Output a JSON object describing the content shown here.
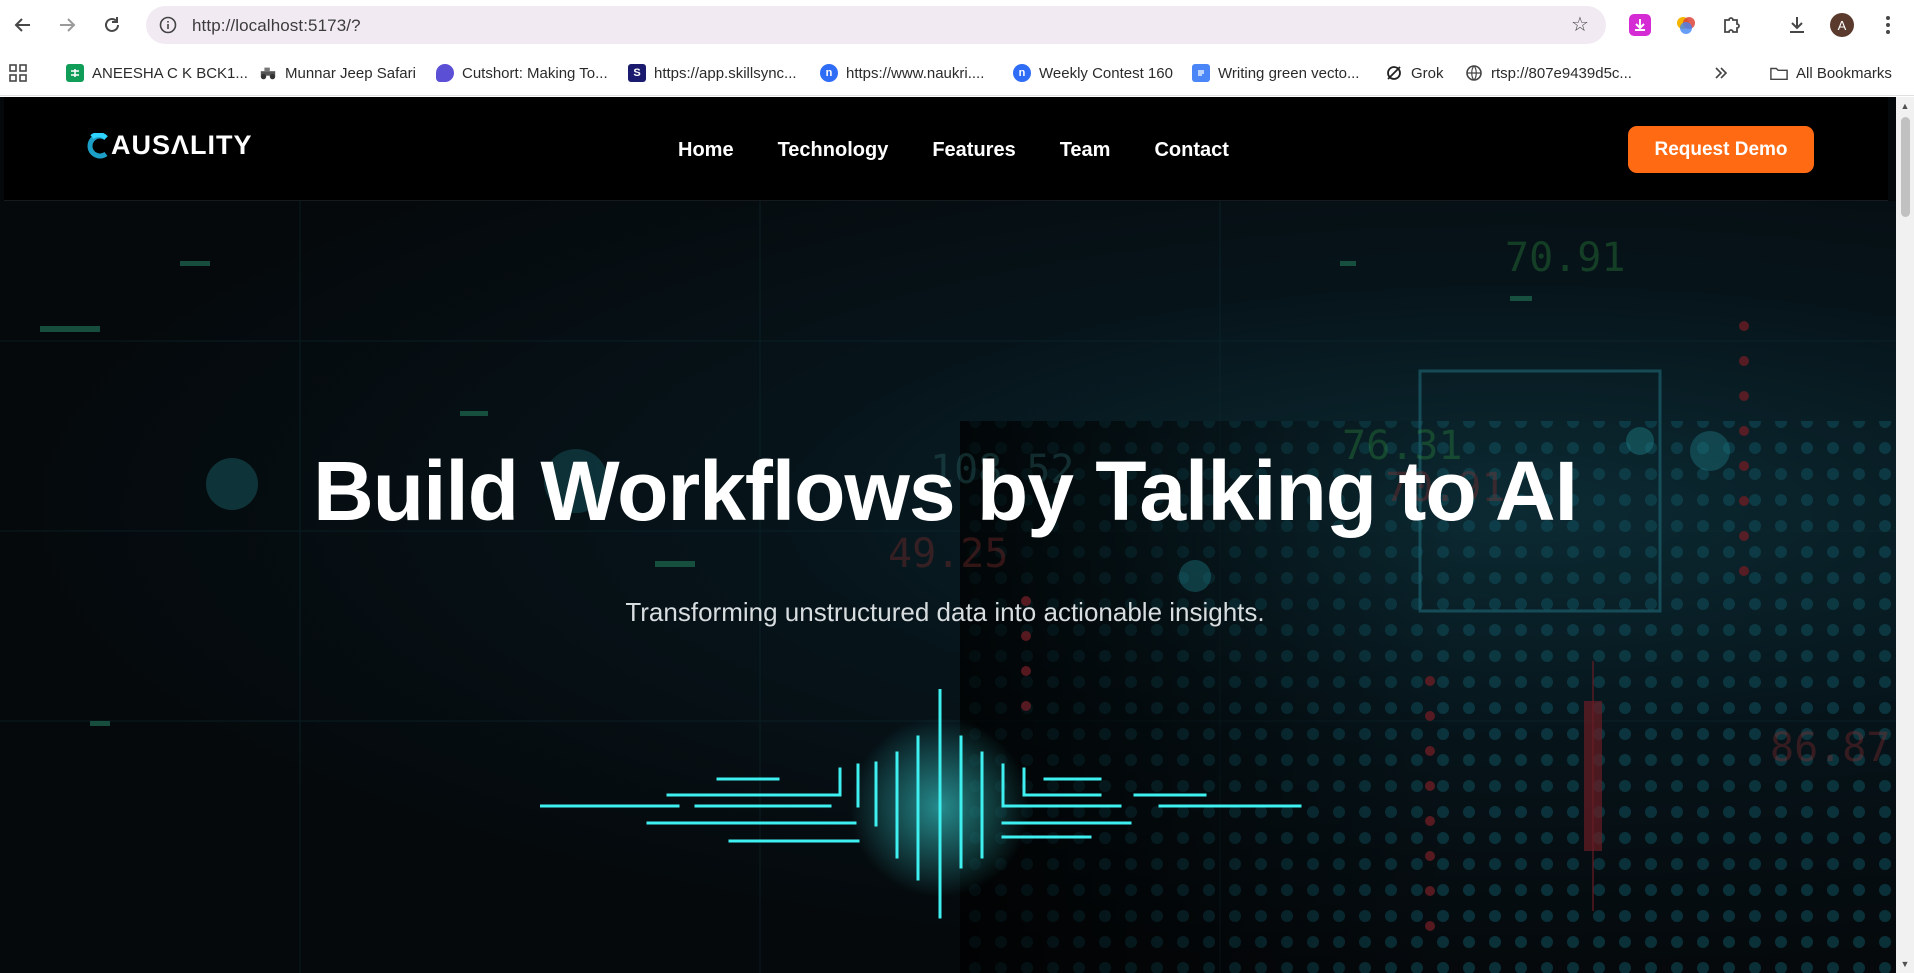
{
  "browser": {
    "url": "http://localhost:5173/?",
    "profile_initial": "A",
    "bookmarks": [
      {
        "label": "ANEESHA C K BCK1...",
        "icon": "sheets-icon"
      },
      {
        "label": "Munnar Jeep Safari",
        "icon": "jeep-icon"
      },
      {
        "label": "Cutshort: Making To...",
        "icon": "cutshort-icon"
      },
      {
        "label": "https://app.skillsync...",
        "icon": "skillsync-icon"
      },
      {
        "label": "https://www.naukri....",
        "icon": "naukri-icon"
      },
      {
        "label": "Weekly Contest 160",
        "icon": "contest-icon"
      },
      {
        "label": "Writing green vecto...",
        "icon": "docs-icon"
      },
      {
        "label": "Grok",
        "icon": "grok-icon"
      },
      {
        "label": "rtsp://807e9439d5c...",
        "icon": "globe-icon"
      }
    ],
    "all_bookmarks_label": "All Bookmarks"
  },
  "site": {
    "logo_text": "AUSΛLITY",
    "nav": [
      "Home",
      "Technology",
      "Features",
      "Team",
      "Contact"
    ],
    "cta_label": "Request Demo",
    "hero_title": "Build Workflows by Talking to AI",
    "hero_subtitle": "Transforming unstructured data into actionable insights.",
    "bg_numbers": [
      "70.91",
      "76.31",
      "70.91",
      "108.52",
      "49.25",
      "86.87"
    ]
  },
  "colors": {
    "cta": "#ff6a13",
    "accent_cyan": "#3ff0f0",
    "bg_dark": "#05080b"
  }
}
